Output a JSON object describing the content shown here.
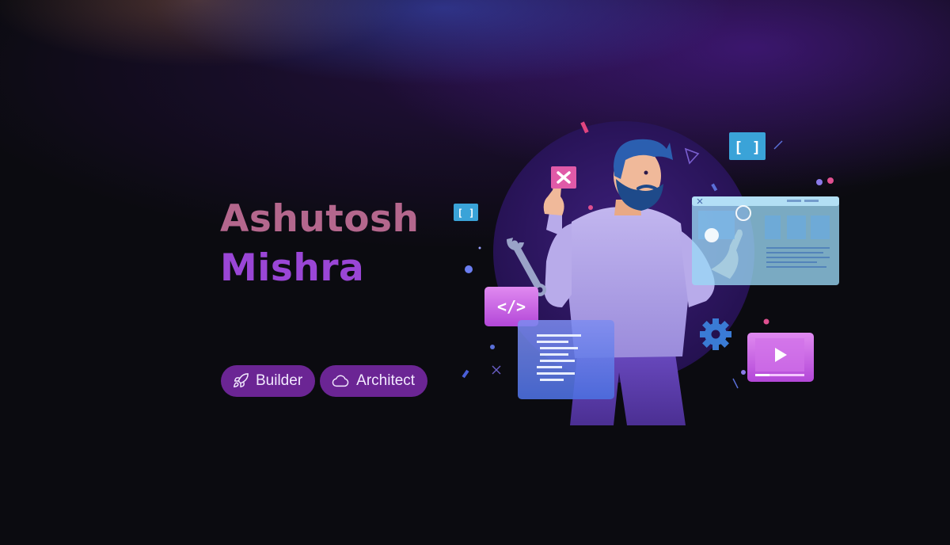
{
  "profile": {
    "first_name": "Ashutosh",
    "last_name": "Mishra"
  },
  "tags": [
    {
      "label": "Builder",
      "icon": "rocket-icon"
    },
    {
      "label": "Architect",
      "icon": "cloud-icon"
    }
  ],
  "illustration": {
    "icons": [
      "close-icon",
      "brackets-icon",
      "code-icon",
      "wrench-icon",
      "gear-icon",
      "play-icon"
    ]
  },
  "colors": {
    "background": "#0b0b10",
    "first_name": "#b4678d",
    "last_name": "#9a46d6",
    "tag_background": "#6b2594",
    "tag_text": "#f3eaff"
  }
}
